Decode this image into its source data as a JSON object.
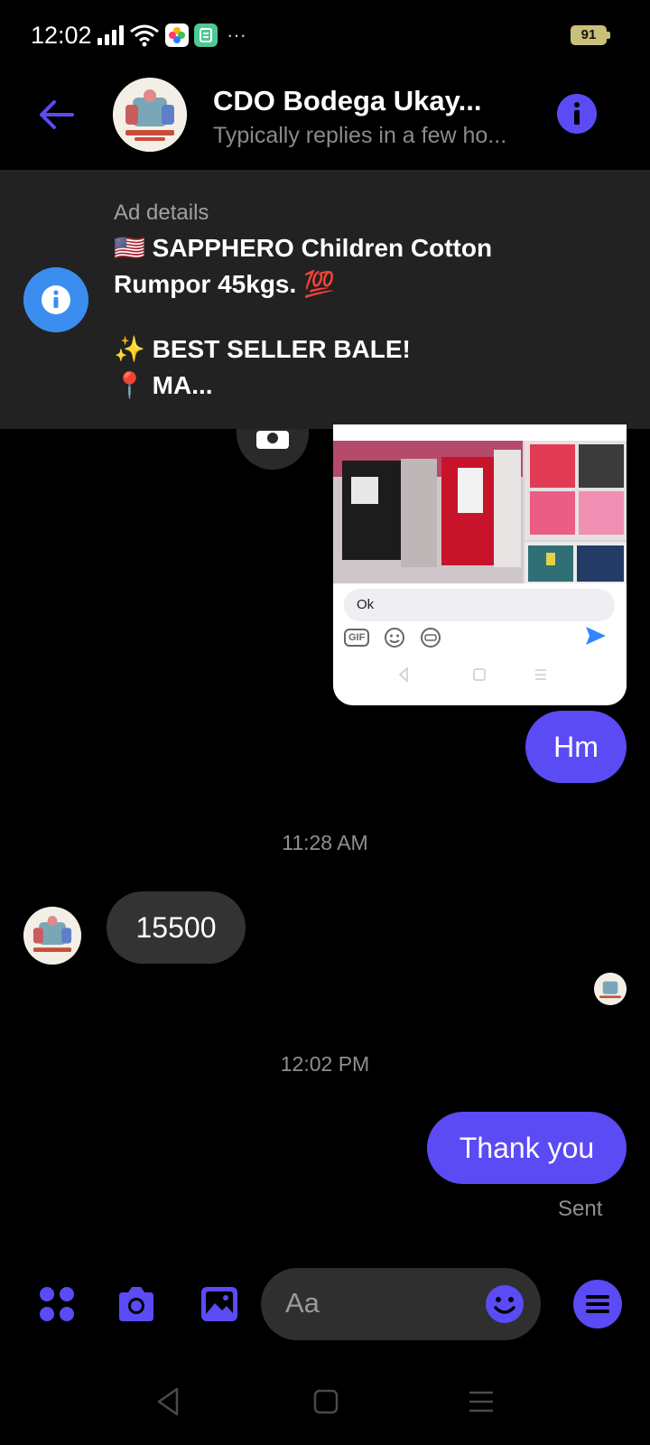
{
  "status_bar": {
    "time": "12:02",
    "more": "···",
    "battery": "91"
  },
  "header": {
    "title": "CDO Bodega Ukay...",
    "subtitle": "Typically replies in a few ho..."
  },
  "ad": {
    "label": "Ad details",
    "line1": "🇺🇸 SAPPHERO  Children Cotton",
    "line2": "Rumpor 45kgs. 💯",
    "line3": "✨ BEST SELLER BALE!",
    "line4": "📍 MA..."
  },
  "screenshot": {
    "input_text": "Ok",
    "gif_label": "GIF"
  },
  "messages": [
    {
      "direction": "outgoing",
      "text": "Hm"
    },
    {
      "timestamp": "11:28 AM"
    },
    {
      "direction": "incoming",
      "text": "15500"
    },
    {
      "timestamp": "12:02 PM"
    },
    {
      "direction": "outgoing",
      "text": "Thank you",
      "status": "Sent"
    }
  ],
  "composer": {
    "placeholder": "Aa"
  },
  "colors": {
    "accent": "#5b4bf5",
    "ad_info": "#3b8ef0",
    "panel": "#222222",
    "incoming_bubble": "#333333"
  }
}
